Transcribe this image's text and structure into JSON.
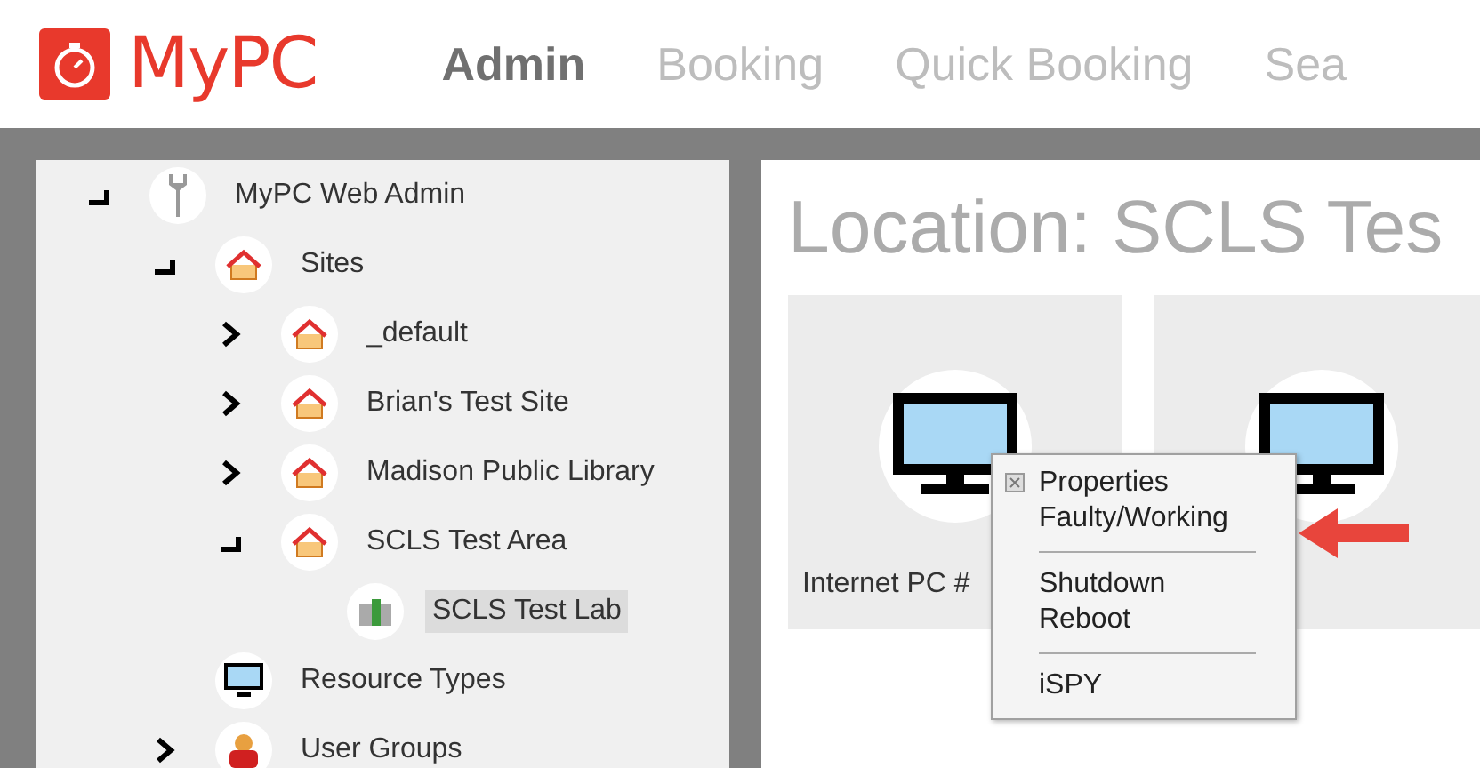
{
  "header": {
    "logo_text": "MyPC",
    "nav": [
      {
        "label": "Admin",
        "selected": true
      },
      {
        "label": "Booking",
        "selected": false
      },
      {
        "label": "Quick Booking",
        "selected": false
      },
      {
        "label": "Sea",
        "selected": false
      }
    ]
  },
  "tree": [
    {
      "label": "MyPC Web Admin",
      "kind": "root",
      "expanded": true,
      "selected": false,
      "children": [
        {
          "label": "Sites",
          "kind": "site",
          "expanded": true,
          "selected": false,
          "children": [
            {
              "label": "_default",
              "kind": "site",
              "expanded": false,
              "selected": false
            },
            {
              "label": "Brian's Test Site",
              "kind": "site",
              "expanded": false,
              "selected": false
            },
            {
              "label": "Madison Public Library",
              "kind": "site",
              "expanded": false,
              "selected": false
            },
            {
              "label": "SCLS Test Area",
              "kind": "site",
              "expanded": true,
              "selected": false,
              "children": [
                {
                  "label": "SCLS Test Lab",
                  "kind": "lab",
                  "selected": true
                }
              ]
            }
          ]
        },
        {
          "label": "Resource Types",
          "kind": "resource",
          "selected": false
        },
        {
          "label": "User Groups",
          "kind": "group",
          "expanded": false,
          "selected": false
        }
      ]
    }
  ],
  "location": {
    "title": "Location: SCLS Tes",
    "cards": [
      {
        "kind": "computer",
        "label": "Internet PC #"
      },
      {
        "kind": "computer"
      }
    ]
  },
  "context_menu": {
    "groups": [
      [
        "Properties",
        "Faulty/Working"
      ],
      [
        "Shutdown",
        "Reboot"
      ],
      [
        "iSPY"
      ]
    ]
  }
}
